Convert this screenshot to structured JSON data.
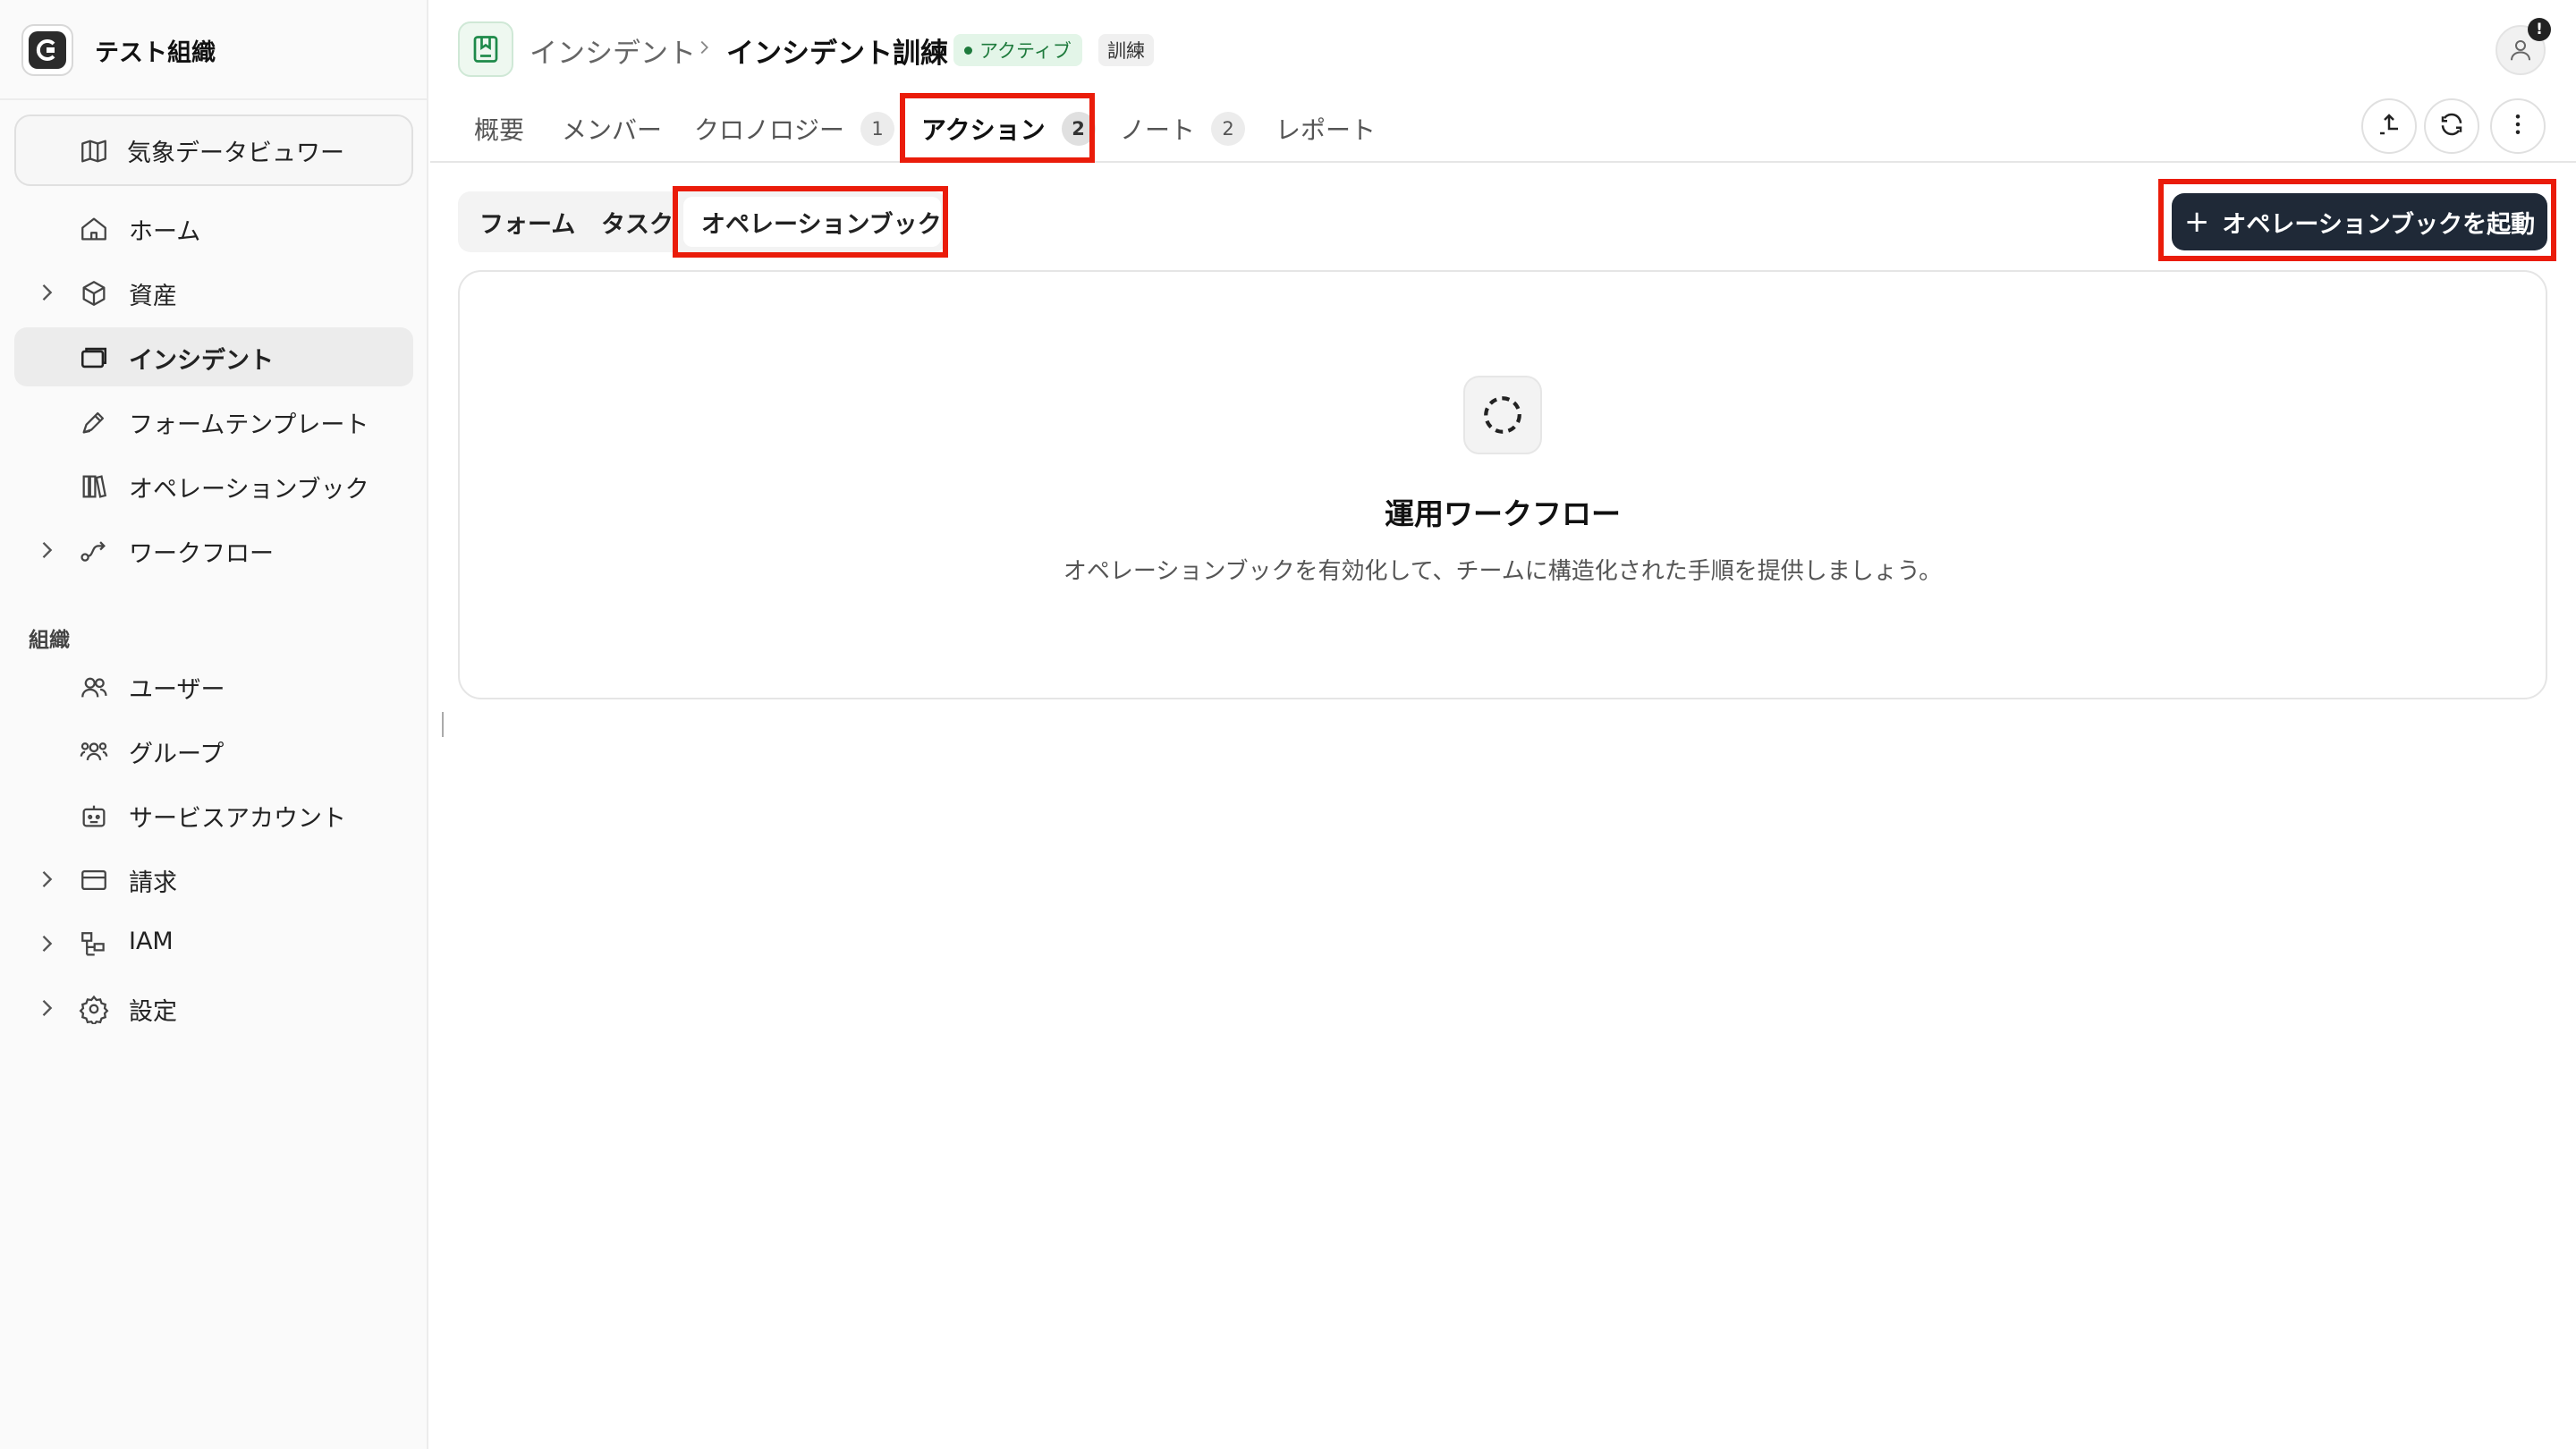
{
  "sidebar": {
    "org_name": "テスト組織",
    "viewer_label": "気象データビュワー",
    "items": [
      {
        "label": "ホーム",
        "icon": "home-icon"
      },
      {
        "label": "資産",
        "icon": "box-icon"
      },
      {
        "label": "インシデント",
        "icon": "incident-icon"
      },
      {
        "label": "フォームテンプレート",
        "icon": "pen-icon"
      },
      {
        "label": "オペレーションブック",
        "icon": "books-icon"
      },
      {
        "label": "ワークフロー",
        "icon": "workflow-icon"
      }
    ],
    "section_title": "組織",
    "org_items": [
      {
        "label": "ユーザー",
        "icon": "users-icon"
      },
      {
        "label": "グループ",
        "icon": "group-icon"
      },
      {
        "label": "サービスアカウント",
        "icon": "bot-icon"
      },
      {
        "label": "請求",
        "icon": "wallet-icon"
      },
      {
        "label": "IAM",
        "icon": "iam-icon"
      },
      {
        "label": "設定",
        "icon": "gear-icon"
      }
    ]
  },
  "header": {
    "breadcrumb_parent": "インシデント",
    "breadcrumb_current": "インシデント訓練",
    "status_badge": "アクティブ",
    "type_badge": "訓練",
    "alert_mark": "!"
  },
  "tabs": [
    {
      "label": "概要",
      "count": null
    },
    {
      "label": "メンバー",
      "count": null
    },
    {
      "label": "クロノロジー",
      "count": "1"
    },
    {
      "label": "アクション",
      "count": "2"
    },
    {
      "label": "ノート",
      "count": "2"
    },
    {
      "label": "レポート",
      "count": null
    }
  ],
  "subtabs": [
    "フォーム",
    "タスク",
    "オペレーションブック"
  ],
  "primary_button": "オペレーションブックを起動",
  "empty_state": {
    "title": "運用ワークフロー",
    "description": "オペレーションブックを有効化して、チームに構造化された手順を提供しましょう。"
  },
  "colors": {
    "highlight": "#ea1c0a",
    "primary": "#1f2937",
    "active_badge_bg": "#e3f5e8",
    "active_badge_fg": "#1e7a3c"
  }
}
